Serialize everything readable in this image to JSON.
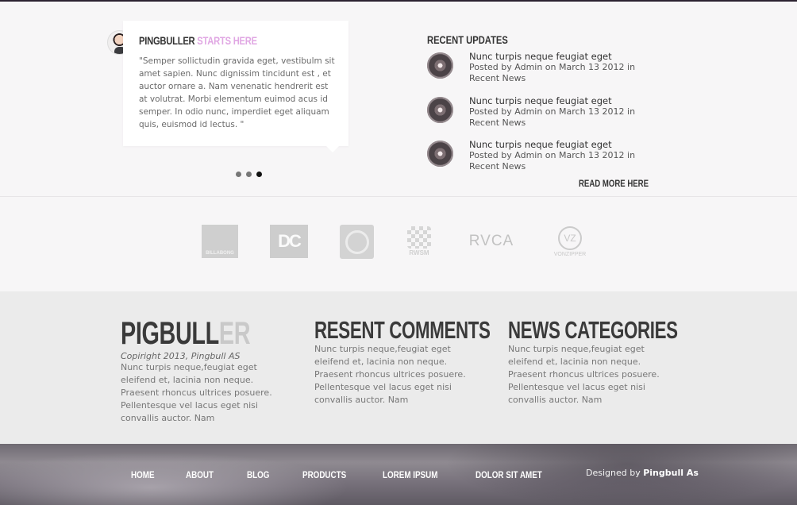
{
  "testimonial": {
    "title_main": "PINGBULLER",
    "title_accent": "STARTS HERE",
    "quote": "\"Semper sollictudin gravida eget, vestibulm sit amet sapien. Nunc dignissim tincidunt est , et auctor ornare a. Nam venenatic hendrerit est at volutrat. Morbi elementum euimod acus id semper. In odio nunc, imperdiet eget aliquam quis, euismod id lectus. \"",
    "slider_dots": 3,
    "active_dot": 3
  },
  "recent_updates": {
    "title": "RECENT UPDATES",
    "items": [
      {
        "title": "Nunc turpis neque feugiat eget",
        "meta": "Posted by Admin on March 13 2012 in Recent News"
      },
      {
        "title": "Nunc turpis neque feugiat eget",
        "meta": "Posted by Admin on March 13 2012 in Recent News"
      },
      {
        "title": "Nunc turpis neque feugiat eget",
        "meta": "Posted by Admin on March 13 2012 in Recent News"
      }
    ],
    "read_more": "READ MORE HERE"
  },
  "brands": {
    "billabong": "BILLABONG",
    "dc": "DC",
    "rwsm": "RWSM",
    "rvca": "RVCA",
    "volcom_mark": "VZ",
    "volcom": "VONZIPPER"
  },
  "footer": {
    "col1": {
      "logo_dark": "PIGBULL",
      "logo_light": "ER",
      "copyright": "Copiright 2013, Pingbull AS",
      "text": "Nunc turpis neque,feugiat eget eleifend et, lacinia non neque. Praesent rhoncus ultrices posuere. Pellentesque vel lacus eget nisi convallis auctor. Nam"
    },
    "col2": {
      "title": "RESENT COMMENTS",
      "text": "Nunc turpis neque,feugiat eget eleifend et, lacinia non neque. Praesent rhoncus ultrices posuere. Pellentesque vel lacus eget nisi convallis auctor. Nam"
    },
    "col3": {
      "title": "NEWS CATEGORIES",
      "text": "Nunc turpis neque,feugiat eget eleifend et, lacinia non neque. Praesent rhoncus ultrices posuere. Pellentesque vel lacus eget nisi convallis auctor. Nam"
    }
  },
  "nav": {
    "items": [
      "HOME",
      "ABOUT",
      "BLOG",
      "PRODUCTS",
      "LOREM IPSUM",
      "DOLOR SIT AMET"
    ]
  },
  "credit": {
    "prefix": "Designed by",
    "name": "Pingbull As"
  },
  "colors": {
    "accent": "#e0a7e3",
    "heading": "#333333",
    "footer_bg": "#ebebeb",
    "page_bg": "#f7f6f7"
  }
}
